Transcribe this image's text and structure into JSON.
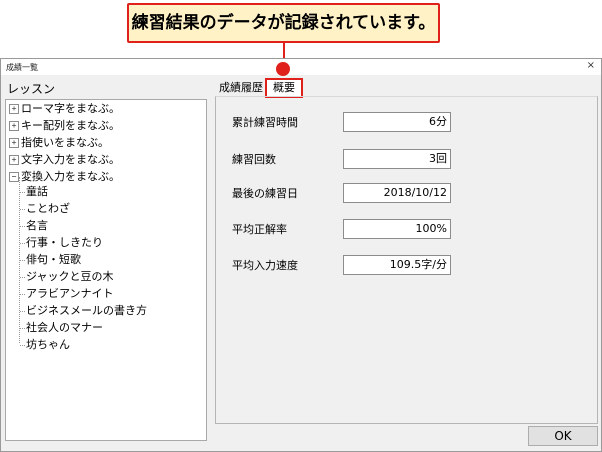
{
  "callout": {
    "text": "練習結果のデータが記録されています。"
  },
  "window": {
    "title": "成績一覧",
    "close_glyph": "×"
  },
  "left_pane": {
    "title": "レッスン",
    "categories": [
      {
        "label": "ローマ字をまなぶ。",
        "toggle": "+"
      },
      {
        "label": "キー配列をまなぶ。",
        "toggle": "+"
      },
      {
        "label": "指使いをまなぶ。",
        "toggle": "+"
      },
      {
        "label": "文字入力をまなぶ。",
        "toggle": "+"
      },
      {
        "label": "変換入力をまなぶ。",
        "toggle": "−"
      }
    ],
    "children": [
      "童話",
      "ことわざ",
      "名言",
      "行事・しきたり",
      "俳句・短歌",
      "ジャックと豆の木",
      "アラビアンナイト",
      "ビジネスメールの書き方",
      "社会人のマナー",
      "坊ちゃん"
    ]
  },
  "tabs": {
    "history": "成績履歴",
    "summary": "概要"
  },
  "summary": {
    "rows": [
      {
        "label": "累計練習時間",
        "value": "6分"
      },
      {
        "label": "練習回数",
        "value": "3回"
      },
      {
        "label": "最後の練習日",
        "value": "2018/10/12"
      },
      {
        "label": "平均正解率",
        "value": "100%"
      },
      {
        "label": "平均入力速度",
        "value": "109.5字/分"
      }
    ]
  },
  "footer": {
    "ok_label": "OK"
  },
  "colors": {
    "highlight": "#e0201b",
    "callout_bg": "#fff2c6",
    "dialog_bg": "#f0f0f0"
  }
}
